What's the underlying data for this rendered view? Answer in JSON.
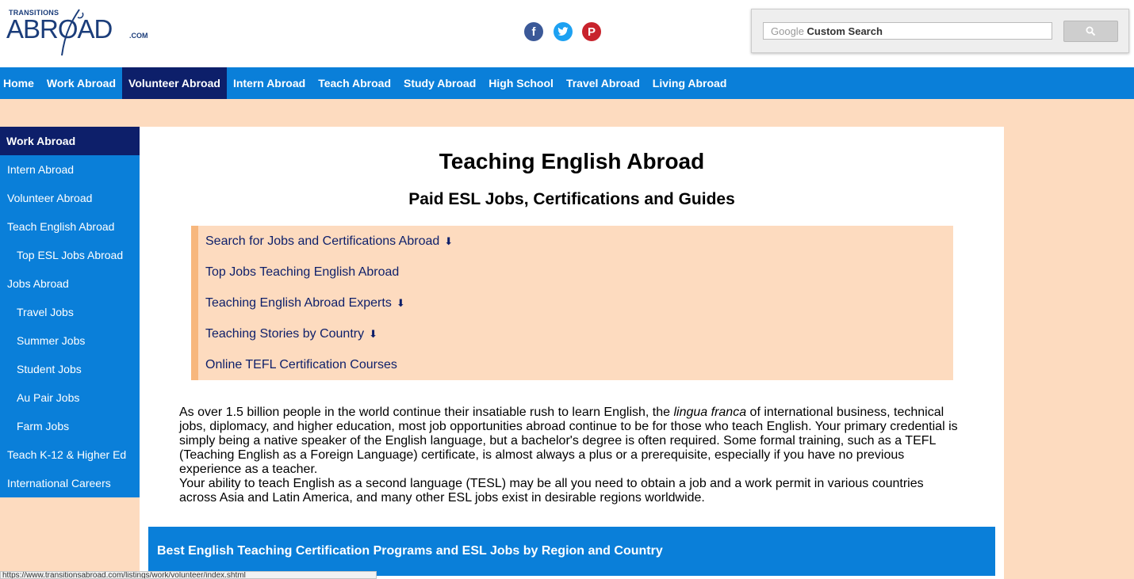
{
  "logo": {
    "top_text": "TRANSITIONS",
    "main_text": "ABROAD",
    "suffix": ".COM"
  },
  "social": [
    {
      "name": "facebook",
      "glyph": "f"
    },
    {
      "name": "twitter",
      "glyph": "t"
    },
    {
      "name": "pinterest",
      "glyph": "P"
    }
  ],
  "search": {
    "placeholder_google": "Google",
    "placeholder_custom": "Custom Search",
    "button_icon": "search-icon"
  },
  "topnav": {
    "items": [
      "Home",
      "Work Abroad",
      "Volunteer Abroad",
      "Intern Abroad",
      "Teach Abroad",
      "Study Abroad",
      "High School",
      "Travel Abroad",
      "Living Abroad"
    ],
    "active": "Volunteer Abroad"
  },
  "sidebar": {
    "items": [
      {
        "label": "Work Abroad",
        "level": 0,
        "active": true
      },
      {
        "label": "Intern Abroad",
        "level": 0
      },
      {
        "label": "Volunteer Abroad",
        "level": 0
      },
      {
        "label": "Teach English Abroad",
        "level": 0
      },
      {
        "label": "Top ESL Jobs Abroad",
        "level": 1
      },
      {
        "label": "Jobs Abroad",
        "level": 0
      },
      {
        "label": "Travel Jobs",
        "level": 1
      },
      {
        "label": "Summer Jobs",
        "level": 1
      },
      {
        "label": "Student Jobs",
        "level": 1
      },
      {
        "label": "Au Pair Jobs",
        "level": 1
      },
      {
        "label": "Farm Jobs",
        "level": 1
      },
      {
        "label": "Teach K-12 & Higher Ed",
        "level": 0
      },
      {
        "label": "International Careers",
        "level": 0
      }
    ]
  },
  "main": {
    "title": "Teaching English Abroad",
    "subtitle": "Paid ESL Jobs, Certifications and Guides",
    "toc": [
      {
        "label": "Search for Jobs and Certifications Abroad",
        "arrow": true
      },
      {
        "label": "Top Jobs Teaching English Abroad",
        "arrow": false
      },
      {
        "label": "Teaching English Abroad Experts",
        "arrow": true
      },
      {
        "label": "Teaching Stories by Country",
        "arrow": true
      },
      {
        "label": "Online TEFL Certification Courses",
        "arrow": false
      }
    ],
    "paragraph1_before": "As over 1.5 billion people in the world continue their insatiable rush to learn English, the ",
    "paragraph1_italic": "lingua franca",
    "paragraph1_after": " of international business, technical jobs, diplomacy, and higher education, most job opportunities abroad continue to be for those who teach English. Your primary credential is simply being a native speaker of the English language, but a bachelor's degree is often required. Some formal training, such as a TEFL (Teaching English as a Foreign Language) certificate, is almost always a plus or a prerequisite, especially if you have no previous experience as a teacher.",
    "paragraph2": "Your ability to teach English as a second language (TESL) may be all you need to obtain a job and a work permit in various countries across Asia and Latin America, and many other ESL jobs exist in desirable regions worldwide.",
    "banner": "Best English Teaching Certification Programs and ESL Jobs by Region and Country"
  },
  "status_bar": {
    "url": "https://www.transitionsabroad.com/listings/work/volunteer/index.shtml"
  },
  "colors": {
    "nav_blue": "#0a7fd9",
    "nav_active": "#0d1f6a",
    "page_bg": "#fddbbf",
    "toc_border": "#f7b77d"
  }
}
